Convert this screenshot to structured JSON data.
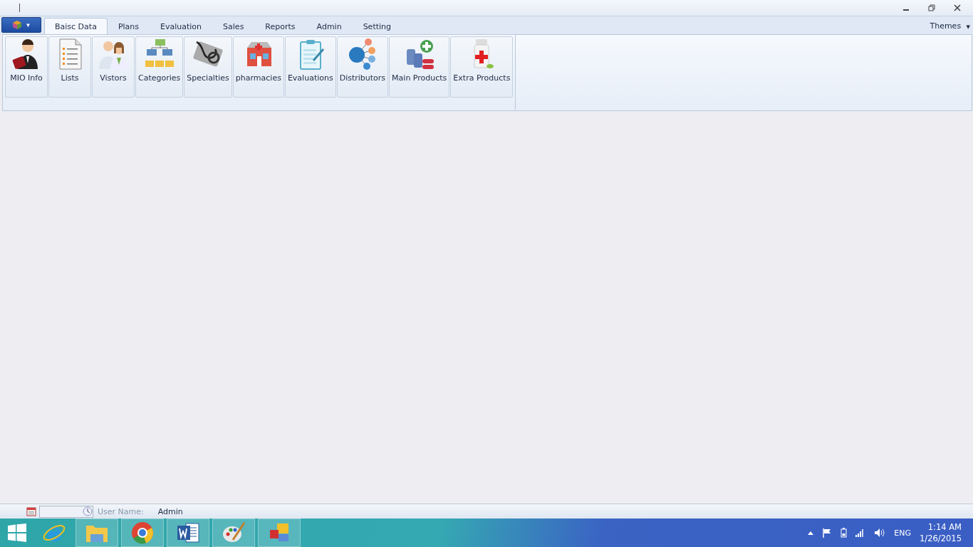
{
  "app_menu": {
    "caret": "▼"
  },
  "tabs": [
    {
      "label": "Baisc Data",
      "selected": true
    },
    {
      "label": "Plans",
      "selected": false
    },
    {
      "label": "Evaluation",
      "selected": false
    },
    {
      "label": "Sales",
      "selected": false
    },
    {
      "label": "Reports",
      "selected": false
    },
    {
      "label": "Admin",
      "selected": false
    },
    {
      "label": "Setting",
      "selected": false
    }
  ],
  "themes": {
    "label": "Themes",
    "caret": "▼"
  },
  "ribbon_buttons": [
    {
      "label": "MIO Info"
    },
    {
      "label": "Lists"
    },
    {
      "label": "Vistors"
    },
    {
      "label": "Categories"
    },
    {
      "label": "Specialties"
    },
    {
      "label": "pharmacies"
    },
    {
      "label": "Evaluations"
    },
    {
      "label": "Distributors"
    },
    {
      "label": "Main Products"
    },
    {
      "label": "Extra Products"
    }
  ],
  "status_bar": {
    "user_label": "User Name:",
    "user": "Admin"
  },
  "taskbar": {
    "language": "ENG",
    "time": "1:14 AM",
    "date": "1/26/2015"
  }
}
